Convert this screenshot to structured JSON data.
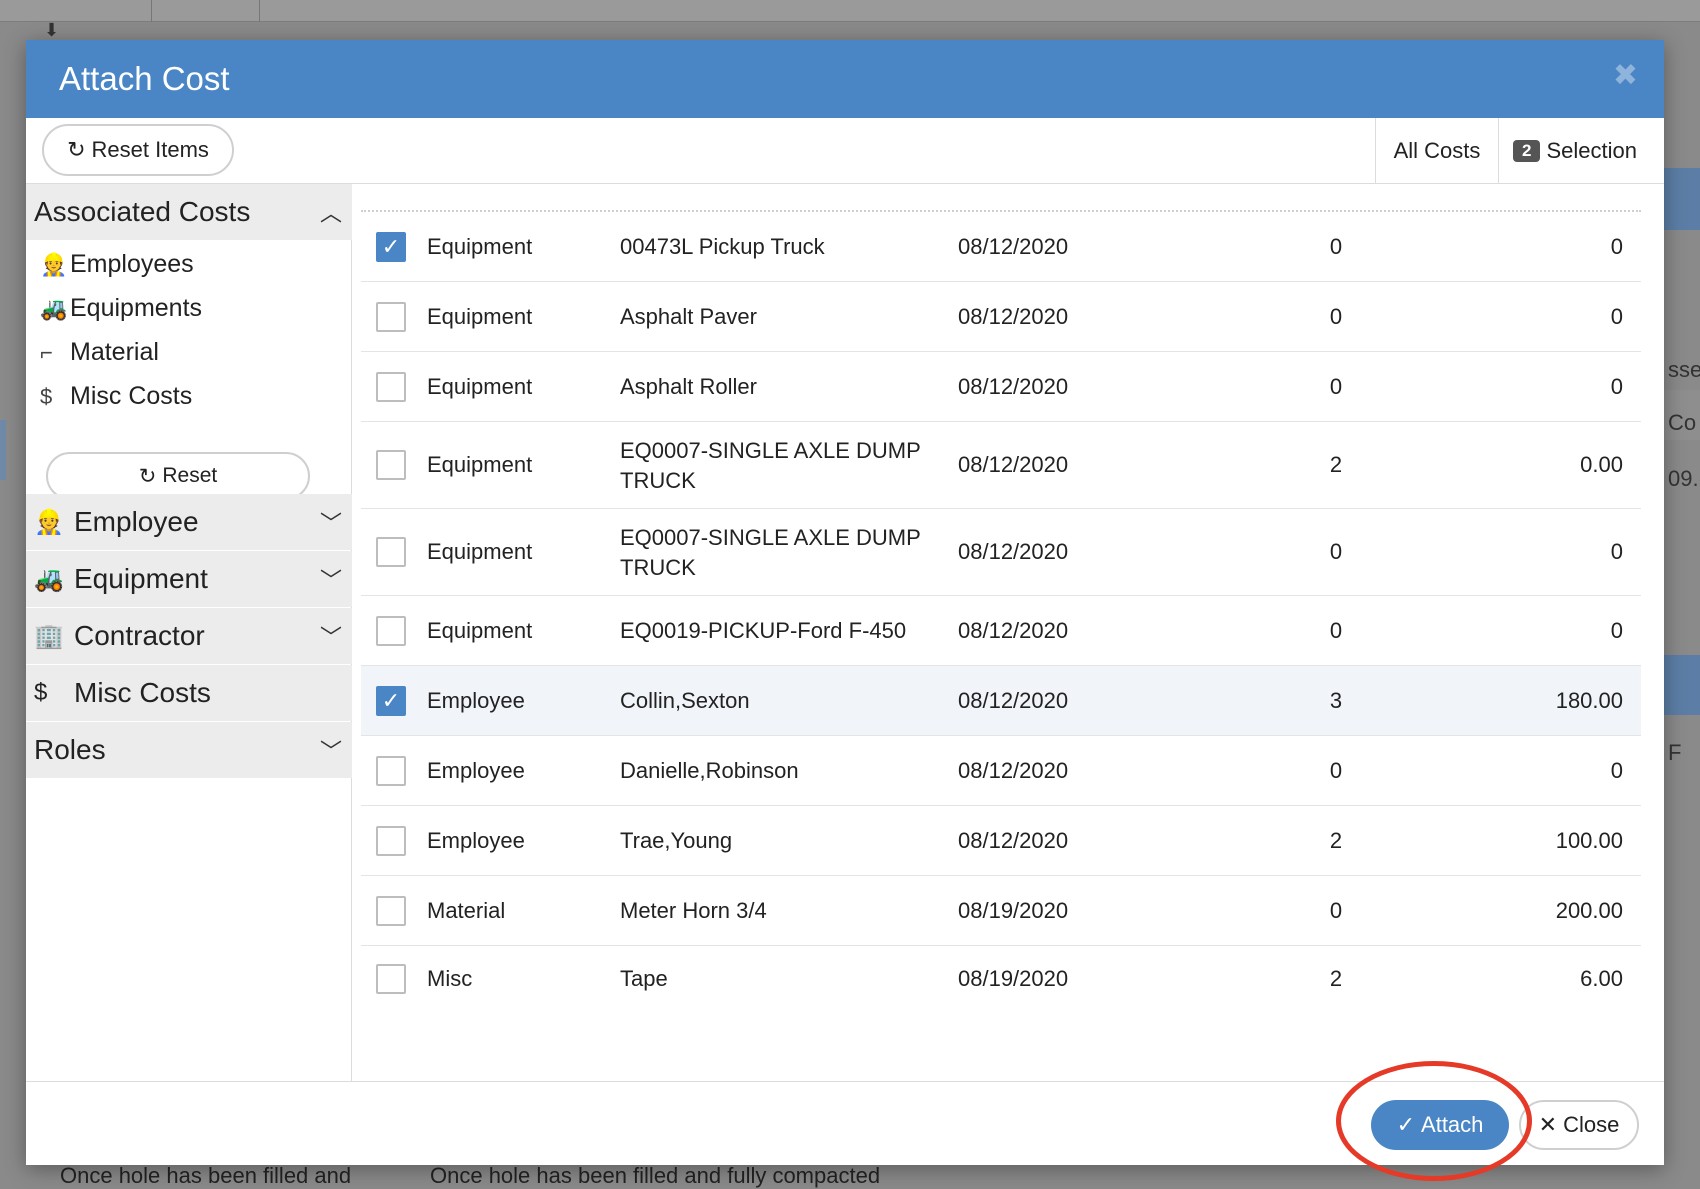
{
  "background": {
    "right_texts": [
      "sse",
      "Co",
      "09.",
      "F"
    ],
    "bottom_texts": [
      "Once hole has been filled and",
      "Once hole has been filled and fully compacted"
    ]
  },
  "modal": {
    "title": "Attach Cost",
    "close_glyph": "✖",
    "toolbar": {
      "reset_items_label": "Reset Items",
      "tab_all_costs": "All Costs",
      "selection_count": "2",
      "tab_selection": "Selection"
    },
    "sidebar": {
      "associated_costs": "Associated Costs",
      "items": [
        {
          "label": "Employees",
          "icon": "worker-icon"
        },
        {
          "label": "Equipments",
          "icon": "excavator-icon"
        },
        {
          "label": "Material",
          "icon": "pipe-icon"
        },
        {
          "label": "Misc Costs",
          "icon": "dollar-icon"
        }
      ],
      "reset_label": "Reset",
      "panels": [
        {
          "label": "Employee",
          "icon": "worker-icon"
        },
        {
          "label": "Equipment",
          "icon": "excavator-icon"
        },
        {
          "label": "Contractor",
          "icon": "contractor-icon"
        },
        {
          "label": "Misc Costs",
          "icon": "dollar-icon"
        },
        {
          "label": "Roles"
        }
      ]
    },
    "rows": [
      {
        "checked": true,
        "type": "Equipment",
        "name": "00473L Pickup Truck",
        "date": "08/12/2020",
        "qty": "0",
        "amount": "0"
      },
      {
        "checked": false,
        "type": "Equipment",
        "name": "Asphalt Paver",
        "date": "08/12/2020",
        "qty": "0",
        "amount": "0"
      },
      {
        "checked": false,
        "type": "Equipment",
        "name": "Asphalt Roller",
        "date": "08/12/2020",
        "qty": "0",
        "amount": "0"
      },
      {
        "checked": false,
        "type": "Equipment",
        "name": "EQ0007-SINGLE AXLE DUMP TRUCK",
        "date": "08/12/2020",
        "qty": "2",
        "amount": "0.00"
      },
      {
        "checked": false,
        "type": "Equipment",
        "name": "EQ0007-SINGLE AXLE DUMP TRUCK",
        "date": "08/12/2020",
        "qty": "0",
        "amount": "0"
      },
      {
        "checked": false,
        "type": "Equipment",
        "name": "EQ0019-PICKUP-Ford F-450",
        "date": "08/12/2020",
        "qty": "0",
        "amount": "0"
      },
      {
        "checked": true,
        "type": "Employee",
        "name": "Collin,Sexton",
        "date": "08/12/2020",
        "qty": "3",
        "amount": "180.00"
      },
      {
        "checked": false,
        "type": "Employee",
        "name": "Danielle,Robinson",
        "date": "08/12/2020",
        "qty": "0",
        "amount": "0"
      },
      {
        "checked": false,
        "type": "Employee",
        "name": "Trae,Young",
        "date": "08/12/2020",
        "qty": "2",
        "amount": "100.00"
      },
      {
        "checked": false,
        "type": "Material",
        "name": "Meter Horn 3/4",
        "date": "08/19/2020",
        "qty": "0",
        "amount": "200.00"
      },
      {
        "checked": false,
        "type": "Misc",
        "name": "Tape",
        "date": "08/19/2020",
        "qty": "2",
        "amount": "6.00"
      }
    ],
    "footer": {
      "attach_label": "Attach",
      "close_label": "Close"
    }
  },
  "colors": {
    "header_blue": "#4a86c5",
    "highlight_red": "#e53a27"
  }
}
